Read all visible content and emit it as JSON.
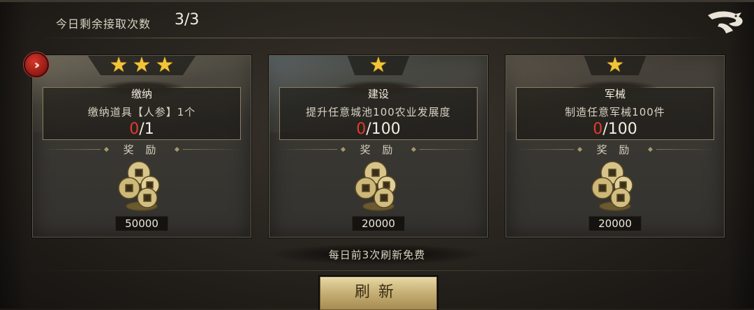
{
  "header": {
    "remaining_label": "今日剩余接取次数",
    "remaining_count": "3/3"
  },
  "quests": [
    {
      "stars": 3,
      "title": "缴纳",
      "description": "缴纳道具【人参】1个",
      "progress_current": "0",
      "progress_total": "/1",
      "reward_label": "奖 励",
      "reward_amount": "50000"
    },
    {
      "stars": 1,
      "title": "建设",
      "description": "提升任意城池100农业发展度",
      "progress_current": "0",
      "progress_total": "/100",
      "reward_label": "奖 励",
      "reward_amount": "20000"
    },
    {
      "stars": 1,
      "title": "军械",
      "description": "制造任意军械100件",
      "progress_current": "0",
      "progress_total": "/100",
      "reward_label": "奖 励",
      "reward_amount": "20000"
    }
  ],
  "footer": {
    "free_refresh_note": "每日前3次刷新免费",
    "refresh_label": "刷新"
  },
  "colors": {
    "star": "#f2c43a",
    "progress_current": "#e53a2e",
    "button_gold": "#c8b277"
  }
}
